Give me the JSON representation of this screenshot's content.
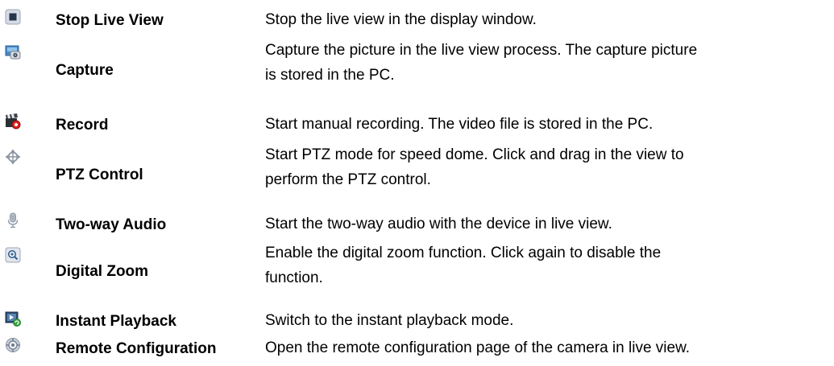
{
  "toolbar_help": {
    "rows": [
      {
        "icon": "stop-live-view-icon",
        "name": "Stop Live View",
        "description": [
          "Stop the live view in the display window."
        ]
      },
      {
        "icon": "capture-icon",
        "name": "Capture",
        "description": [
          "Capture the picture in the live view process. The capture picture",
          "is stored in the PC."
        ]
      },
      {
        "icon": "record-icon",
        "name": "Record",
        "description": [
          "Start manual recording. The video file is stored in the PC."
        ]
      },
      {
        "icon": "ptz-control-icon",
        "name": "PTZ Control",
        "description": [
          "Start PTZ mode for speed dome. Click and drag in the view to",
          "perform the PTZ control."
        ]
      },
      {
        "icon": "two-way-audio-icon",
        "name": "Two-way Audio",
        "description": [
          "Start the two-way audio with the device in live view."
        ]
      },
      {
        "icon": "digital-zoom-icon",
        "name": "Digital Zoom",
        "description": [
          "Enable the digital zoom function. Click again to disable the",
          "function."
        ]
      },
      {
        "icon": "instant-playback-icon",
        "name": "Instant Playback",
        "description": [
          "Switch to the instant playback mode."
        ]
      },
      {
        "icon": "remote-configuration-icon",
        "name": "Remote Configuration",
        "description": [
          "Open the remote configuration page of the camera in live view."
        ]
      }
    ]
  }
}
